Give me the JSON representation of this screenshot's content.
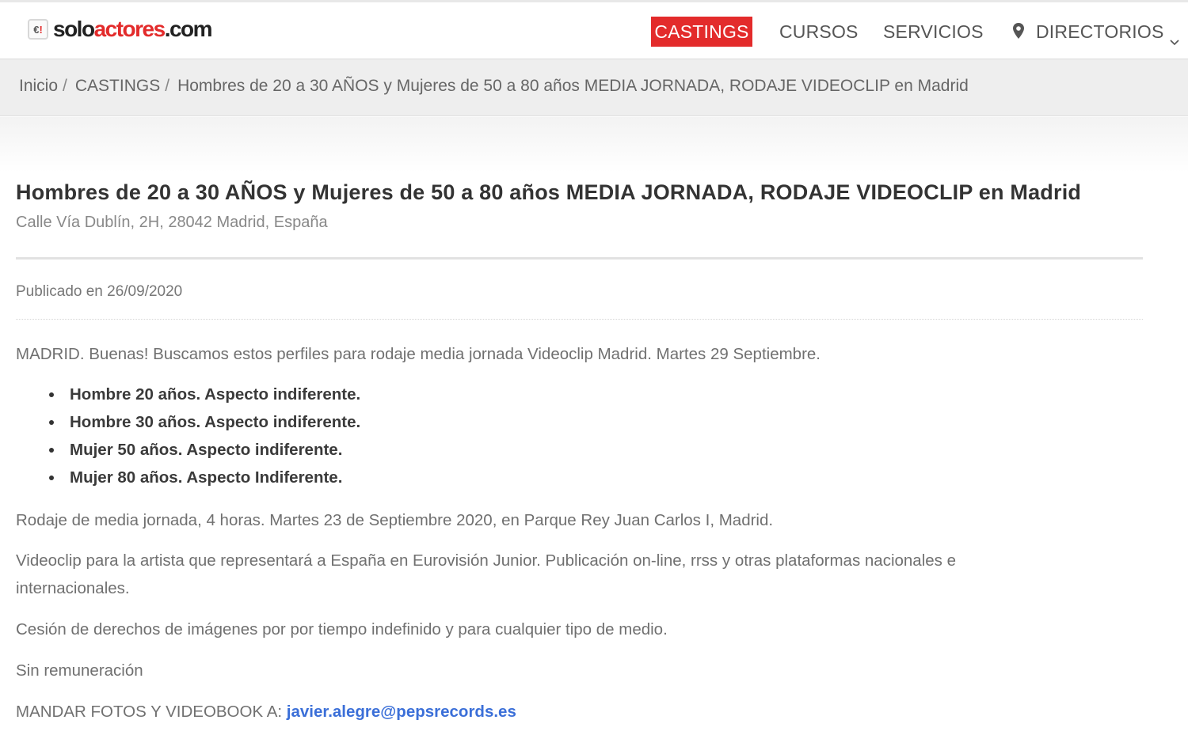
{
  "header": {
    "logo": {
      "prefix": "solo",
      "accent": "actores",
      "suffix": ".com"
    },
    "nav": {
      "castings": "CASTINGS",
      "cursos": "CURSOS",
      "servicios": "SERVICIOS",
      "directorios": "DIRECTORIOS"
    }
  },
  "breadcrumb": {
    "items": [
      "Inicio",
      "CASTINGS",
      "Hombres de 20 a 30 AÑOS y Mujeres de 50 a 80 años MEDIA JORNADA, RODAJE VIDEOCLIP en Madrid"
    ],
    "separator": "/"
  },
  "listing": {
    "title": "Hombres de 20 a 30 AÑOS y Mujeres de 50 a 80 años MEDIA JORNADA, RODAJE VIDEOCLIP en Madrid",
    "address": "Calle Vía Dublín, 2H, 28042 Madrid, España",
    "published": "Publicado en 26/09/2020",
    "intro": "MADRID. Buenas! Buscamos estos perfiles para rodaje media jornada Videoclip Madrid. Martes 29 Septiembre.",
    "profiles": [
      "Hombre 20 años. Aspecto indiferente.",
      "Hombre 30 años. Aspecto indiferente.",
      "Mujer 50 años. Aspecto indiferente.",
      "Mujer 80 años. Aspecto Indiferente."
    ],
    "details": "Rodaje de media jornada, 4 horas. Martes 23 de Septiembre 2020, en Parque Rey Juan Carlos I, Madrid.",
    "description": "Videoclip para la artista que representará a España en Eurovisión Junior. Publicación on-line, rrss y otras plataformas nacionales e internacionales.",
    "rights": "Cesión de derechos de imágenes por por tiempo indefinido y para cualquier tipo de medio.",
    "pay": "Sin remuneración",
    "contact_label": "MANDAR FOTOS Y VIDEOBOOK A:",
    "contact_email": "javier.alegre@pepsrecords.es"
  },
  "colors": {
    "brand_red": "#e32b2b",
    "link_blue": "#3b6fd8"
  },
  "icons": {
    "directorios": "map-pin-icon",
    "dropdown": "chevron-down-icon"
  }
}
